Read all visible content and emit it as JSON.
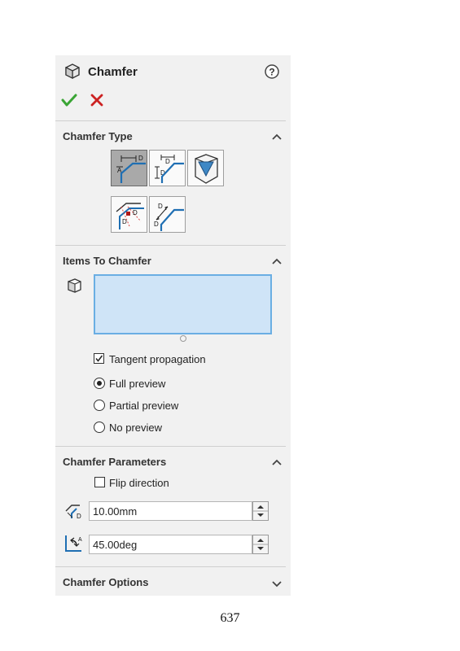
{
  "panel": {
    "title": "Chamfer",
    "icons": {
      "feature": "chamfer-feature-icon",
      "help": "help-icon",
      "ok": "ok-check-icon",
      "cancel": "cancel-x-icon"
    }
  },
  "chamfer_type": {
    "title": "Chamfer Type",
    "expanded": true,
    "options": [
      {
        "name": "angle-distance",
        "selected": true
      },
      {
        "name": "distance-distance",
        "selected": false
      },
      {
        "name": "vertex",
        "selected": false
      },
      {
        "name": "offset-face",
        "selected": false
      },
      {
        "name": "face-face",
        "selected": false
      }
    ]
  },
  "items_to_chamfer": {
    "title": "Items To Chamfer",
    "expanded": true,
    "tangent_propagation": {
      "label": "Tangent propagation",
      "checked": true
    },
    "preview_options": [
      {
        "label": "Full preview",
        "selected": true
      },
      {
        "label": "Partial preview",
        "selected": false
      },
      {
        "label": "No preview",
        "selected": false
      }
    ]
  },
  "chamfer_parameters": {
    "title": "Chamfer Parameters",
    "expanded": true,
    "flip_direction": {
      "label": "Flip direction",
      "checked": false
    },
    "distance": "10.00mm",
    "angle": "45.00deg"
  },
  "chamfer_options": {
    "title": "Chamfer Options",
    "expanded": false
  },
  "page_number": "637",
  "colors": {
    "panel_bg": "#f1f1f1",
    "selection_box_fill": "#cfe4f7",
    "selection_box_border": "#6aaee3",
    "ok_green": "#3aa535",
    "cancel_red": "#cc2222",
    "accent_blue": "#1f6fb3"
  }
}
